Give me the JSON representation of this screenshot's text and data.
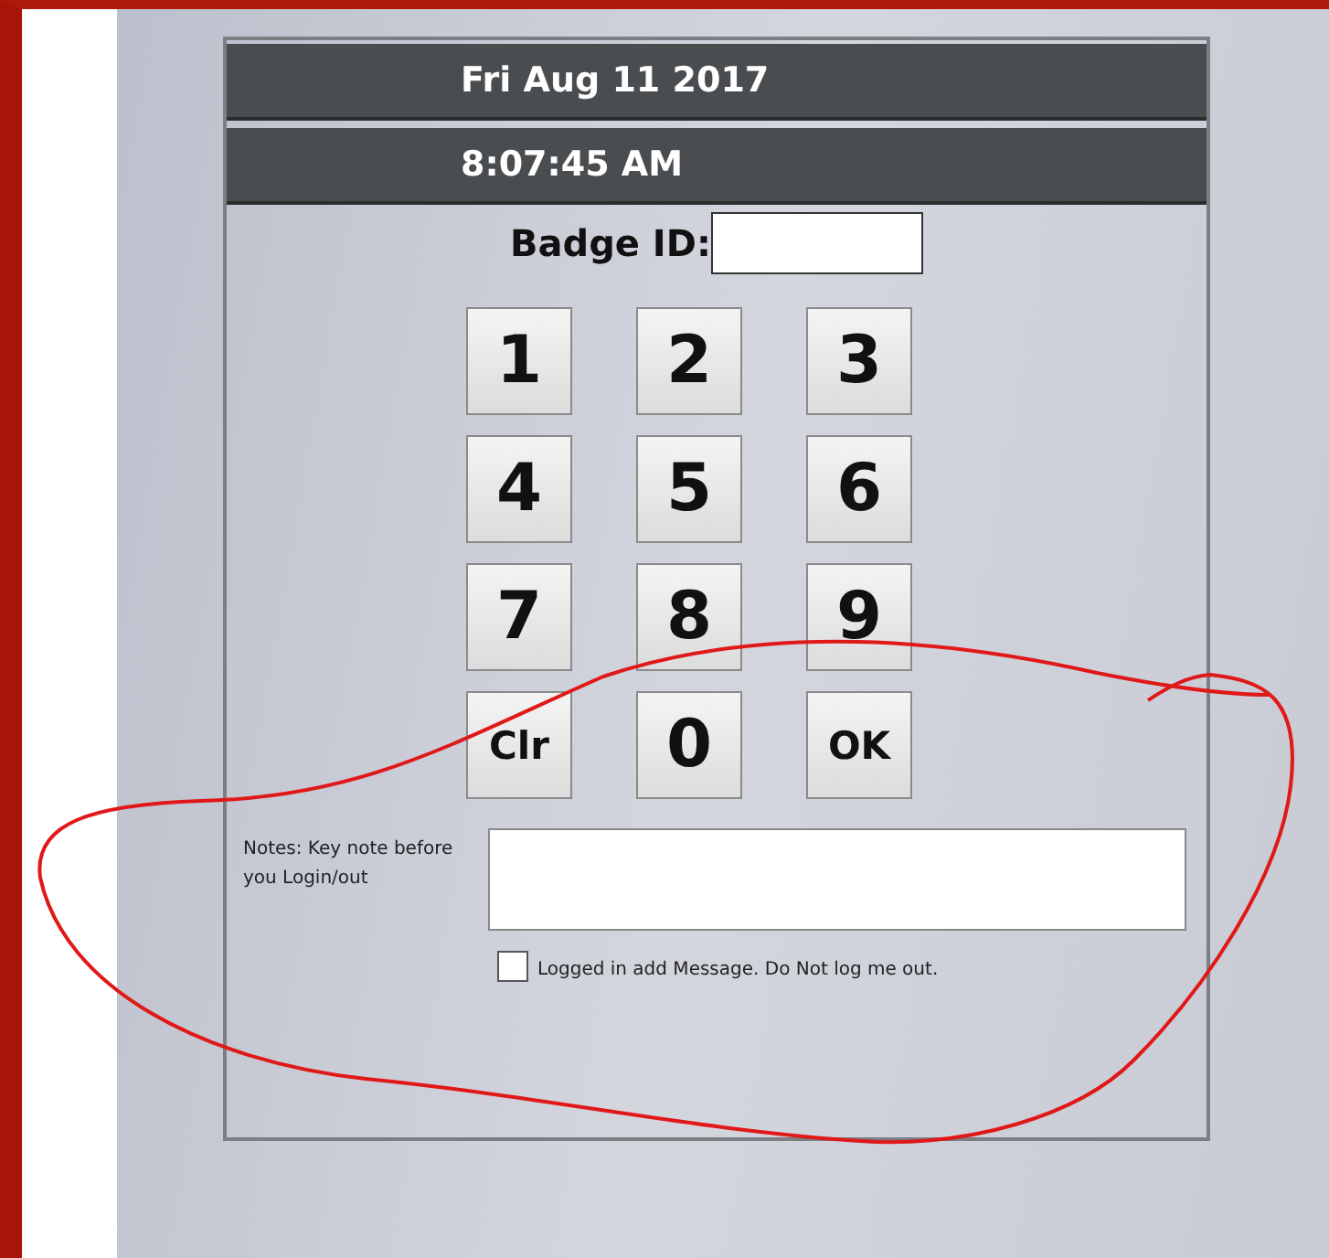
{
  "header": {
    "date": "Fri Aug 11 2017",
    "time": "8:07:45 AM"
  },
  "badge": {
    "label": "Badge ID:"
  },
  "keypad": [
    {
      "label": "1",
      "kind": "digit"
    },
    {
      "label": "2",
      "kind": "digit"
    },
    {
      "label": "3",
      "kind": "digit"
    },
    {
      "label": "4",
      "kind": "digit"
    },
    {
      "label": "5",
      "kind": "digit"
    },
    {
      "label": "6",
      "kind": "digit"
    },
    {
      "label": "7",
      "kind": "digit"
    },
    {
      "label": "8",
      "kind": "digit"
    },
    {
      "label": "9",
      "kind": "digit"
    },
    {
      "label": "Clr",
      "kind": "command"
    },
    {
      "label": "0",
      "kind": "digit"
    },
    {
      "label": "OK",
      "kind": "command"
    }
  ],
  "notes": {
    "label": "Notes: Key note before you Login/out"
  },
  "keep_logged_in": {
    "label": "Logged in add Message. Do Not log me out.",
    "checked": false
  }
}
